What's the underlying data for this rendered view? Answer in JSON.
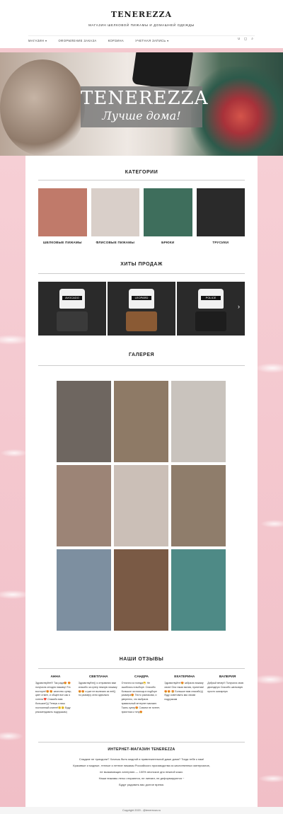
{
  "header": {
    "logo": "TENEREZZA",
    "tagline": "МАГАЗИН ШЕЛКОВОЙ ПИЖАМЫ И ДОМАШНЕЙ ОДЕЖДЫ",
    "nav": [
      "МАГАЗИН",
      "ОФОРМЛЕНИЕ ЗАКАЗА",
      "КОРЗИНА",
      "УЧЕТНАЯ ЗАПИСЬ"
    ],
    "nav_dropdown_flags": [
      true,
      false,
      false,
      true
    ]
  },
  "hero": {
    "title": "TENEREZZA",
    "subtitle": "Лучше дома!"
  },
  "sections": {
    "categories": "КАТЕГОРИИ",
    "hits": "ХИТЫ ПРОДАЖ",
    "gallery": "ГАЛЕРЕЯ",
    "reviews": "НАШИ ОТЗЫВЫ"
  },
  "categories": [
    {
      "label": "ШЕЛКОВЫЕ ПИЖАМЫ",
      "color": "#c07a6a"
    },
    {
      "label": "ФЛИСОВЫЕ ПИЖАМЫ",
      "color": "#d9cfc9"
    },
    {
      "label": "БРЮКИ",
      "color": "#3e6e5c"
    },
    {
      "label": "ТРУСИКИ",
      "color": "#2a2a2a"
    }
  ],
  "hits": [
    {
      "badge": "AVOCADO",
      "shorts_color": "#3a3a3a"
    },
    {
      "badge": "LEOPARD",
      "shorts_color": "#8a5a34"
    },
    {
      "badge": "POLICE",
      "shorts_color": "#1d1d1d"
    }
  ],
  "gallery_colors": [
    "#6e6660",
    "#8e7a66",
    "#c9c3bd",
    "#9c8476",
    "#cbbfb7",
    "#8f7d6b",
    "#7d8fa0",
    "#7a5a45",
    "#4e8a86"
  ],
  "reviews": [
    {
      "name": "АННА",
      "text": "Здравствуйте!!! Так рада😍 😍 получила сегодня пижаму! Я в восторге!😍 😍 качество супер, цвет отмен, и общее все как я хотела ❤️ Спасибо вам большое!))) Теперь я ваш постоянный клиент!🙂😉 Буду рекомендовать подружкам)"
    },
    {
      "name": "СВЕТЛАНА",
      "text": "Здравствуйте)) я отправляю вам спасибо за супер нежную пижаму😍😍 я уже не вылезаю из неё)) по размеру сели идеально"
    },
    {
      "name": "САНДРА",
      "text": "Отлично из поезда😁 Не ошиблась в выборе. Спасибо большое за помощь в подборе размера😍 Тесто распакова, и уверенно, что выбрала правильный интернет магазин. Ткань супер😍 Совсем не потеет, приятная к телу😍"
    },
    {
      "name": "ЕКАТЕРИНА",
      "text": "Здравствуйте!😍 забрала пижаму свою! Она такая милая, приятная!😍😍 🤩 Большое вам спасибо))) буду советовать вас своим подружкам"
    },
    {
      "name": "ВАЛЕРИЯ",
      "text": "Добрый вечер!! Получила свою двоездную Спасибо шелковую просто шикарную"
    }
  ],
  "about": {
    "title": "ИНТЕРНЕТ-МАГАЗИН TENEREZZA",
    "lines": [
      "Сладкие не тумсдили? Хочешь быть модной и привлекательной даже дома? Тогда тебе к нам!",
      "Красивые и модные, теплые и летние пижамы Российского производства из качественных материалов,",
      "не вызывающих аллергию — 100% японское дно нежной кожи.",
      "Наши пижамы легко стираются, не линяют, не деформируются ~",
      "Будут радовать вас долгое время."
    ]
  },
  "footer": "Copyright 2020 - @tenerezza.ru"
}
